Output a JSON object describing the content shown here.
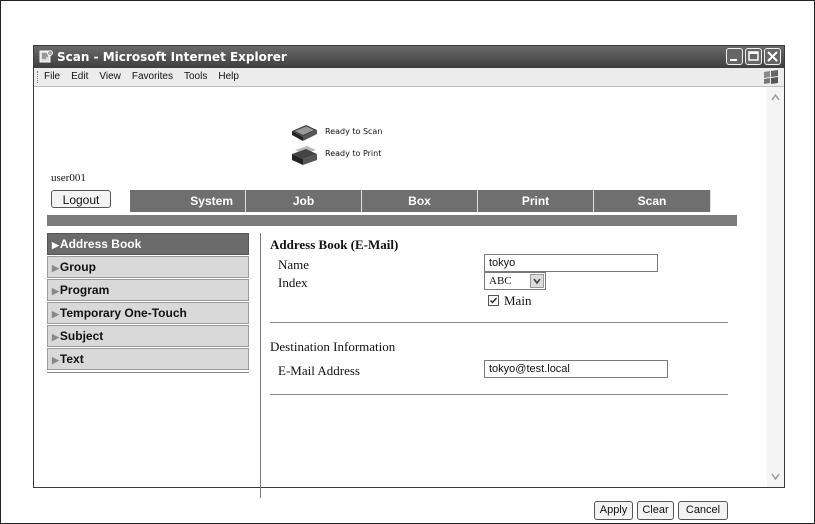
{
  "window": {
    "title": "Scan - Microsoft Internet Explorer"
  },
  "menu": [
    "File",
    "Edit",
    "View",
    "Favorites",
    "Tools",
    "Help"
  ],
  "status": {
    "scan": "Ready to Scan",
    "print": "Ready to Print"
  },
  "user": "user001",
  "logout_label": "Logout",
  "tabs": [
    "System",
    "Job",
    "Box",
    "Print",
    "Scan"
  ],
  "nav": [
    "Address Book",
    "Group",
    "Program",
    "Temporary One-Touch",
    "Subject",
    "Text"
  ],
  "form": {
    "title": "Address Book (E-Mail)",
    "name_label": "Name",
    "name_value": "tokyo",
    "index_label": "Index",
    "index_value": "ABC",
    "main_label": "Main",
    "main_checked": true,
    "dest_heading": "Destination Information",
    "email_label": "E-Mail Address",
    "email_value": "tokyo@test.local"
  },
  "buttons": {
    "apply": "Apply",
    "clear": "Clear",
    "cancel": "Cancel"
  }
}
